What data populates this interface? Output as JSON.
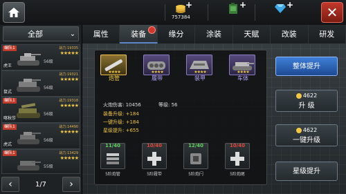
{
  "resources": [
    {
      "name": "gold-coins",
      "value": "757384"
    },
    {
      "name": "fuel-can",
      "value": ""
    },
    {
      "name": "diamonds",
      "value": ""
    }
  ],
  "filter": {
    "label": "全部"
  },
  "tanks": [
    {
      "tag": "编队1",
      "power": "战力:19335",
      "level": "56级",
      "name": "虎王",
      "stars": "★★★★★"
    },
    {
      "tag": "",
      "power": "战力:19321",
      "level": "56级",
      "name": "鼠式",
      "stars": "★★★★★"
    },
    {
      "tag": "编队1",
      "power": "战力:19318",
      "level": "56级",
      "name": "喀秋莎",
      "stars": "★★★★★"
    },
    {
      "tag": "编队1",
      "power": "战力:14490",
      "level": "56级",
      "name": "虎式",
      "stars": "★★★★★"
    },
    {
      "tag": "编队1",
      "power": "战力:13429",
      "level": "55级",
      "name": "",
      "stars": "★★★★★"
    }
  ],
  "pager": {
    "text": "1/7"
  },
  "tabs": [
    "属性",
    "装备",
    "缘分",
    "涂装",
    "天赋",
    "改装",
    "研发"
  ],
  "parts": [
    {
      "label": "炮管",
      "stars": "★★★★"
    },
    {
      "label": "履带",
      "stars": "★★★★"
    },
    {
      "label": "装甲",
      "stars": "★★★★"
    },
    {
      "label": "车体",
      "stars": "★★★★"
    }
  ],
  "stats": {
    "firepower": "火炮伤害: 10456",
    "level": "等级: 56",
    "upgrade": "装备升级: +184",
    "oneclick": "一键升级: +184",
    "star": "星级提升: +655"
  },
  "materials": [
    {
      "count": "11/40",
      "count_color": "#5fd35f",
      "name": "5阶炮管"
    },
    {
      "count": "10/40",
      "count_color": "#e2463a",
      "name": "5阶履带"
    },
    {
      "count": "12/40",
      "count_color": "#5fd35f",
      "name": "5阶炮闩"
    },
    {
      "count": "10/40",
      "count_color": "#e2463a",
      "name": "5阶炮尾"
    }
  ],
  "buttons": {
    "overall": "整体提升",
    "upgrade_cost": "4622",
    "upgrade": "升 级",
    "oneclick_cost": "4622",
    "oneclick": "一键升级",
    "star": "星级提升"
  }
}
